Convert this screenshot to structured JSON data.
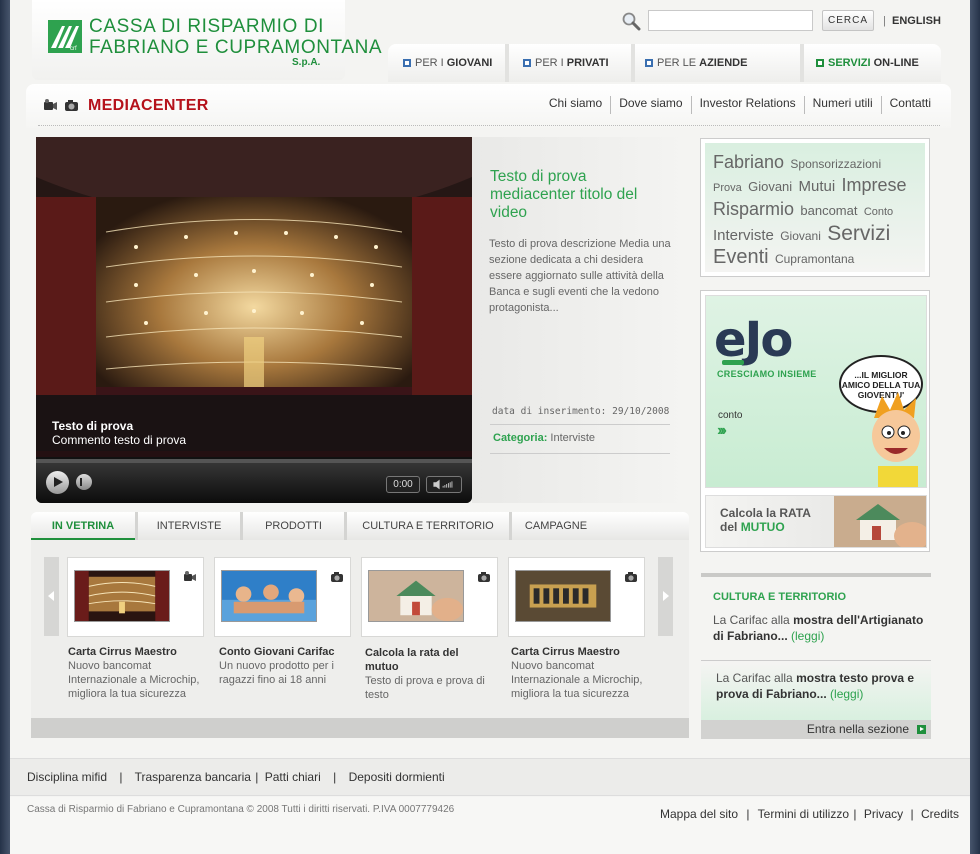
{
  "brand": {
    "line1": "CASSA DI RISPARMIO DI",
    "line2": "FABRIANO E CUPRAMONTANA",
    "spa": "S.p.A."
  },
  "search": {
    "placeholder": "",
    "button": "CERCA"
  },
  "lang": {
    "separator": "|",
    "label": "ENGLISH"
  },
  "main_nav": [
    {
      "prefix": "PER I",
      "label": "GIOVANI"
    },
    {
      "prefix": "PER I",
      "label": "PRIVATI"
    },
    {
      "prefix": "PER LE",
      "label": "AZIENDE"
    },
    {
      "prefix": "SERVIZI",
      "label": "ON-LINE"
    }
  ],
  "section": {
    "title": "MEDIACENTER"
  },
  "top_links": [
    "Chi siamo",
    "Dove siamo",
    "Investor Relations",
    "Numeri utili",
    "Contatti"
  ],
  "video": {
    "caption_title": "Testo di prova",
    "caption_sub": "Commento testo di prova",
    "time": "0:00"
  },
  "video_info": {
    "title": "Testo di prova mediacenter titolo del video",
    "description": "Testo di prova descrizione Media una sezione dedicata a chi desidera essere aggiornato sulle attività della Banca e sugli eventi che la vedono protagonista...",
    "date": "data di inserimento: 29/10/2008",
    "category_label": "Categoria:",
    "category_value": "Interviste"
  },
  "tabs": [
    "IN VETRINA",
    "INTERVISTE",
    "PRODOTTI",
    "CULTURA E TERRITORIO",
    "CAMPAGNE"
  ],
  "cards": [
    {
      "title": "Carta Cirrus Maestro",
      "desc": "Nuovo bancomat Internazionale a Microchip, migliora la tua sicurezza",
      "type": "video"
    },
    {
      "title": "Conto Giovani Carifac",
      "desc": "Un nuovo prodotto per i ragazzi fino ai 18 anni",
      "type": "photo"
    },
    {
      "title": "Calcola la rata del mutuo",
      "desc": "Testo di prova e prova di testo",
      "type": "photo"
    },
    {
      "title": "Carta Cirrus Maestro",
      "desc": "Nuovo bancomat Internazionale a Microchip, migliora la tua sicurezza",
      "type": "photo"
    }
  ],
  "tagcloud": [
    {
      "word": "Fabriano",
      "size": 18
    },
    {
      "word": "Sponsorizzazioni",
      "size": 12
    },
    {
      "word": "Prova",
      "size": 11
    },
    {
      "word": "Giovani",
      "size": 13
    },
    {
      "word": "Mutui",
      "size": 15
    },
    {
      "word": "Imprese",
      "size": 18
    },
    {
      "word": "Risparmio",
      "size": 18
    },
    {
      "word": "bancomat",
      "size": 13
    },
    {
      "word": "Conto",
      "size": 11
    },
    {
      "word": "Interviste",
      "size": 15
    },
    {
      "word": "Giovani",
      "size": 12
    },
    {
      "word": "Servizi",
      "size": 21
    },
    {
      "word": "Eventi",
      "size": 20
    },
    {
      "word": "Cupramontana",
      "size": 12
    }
  ],
  "ad": {
    "logo": "eJo",
    "tagline": "CRESCIAMO INSIEME",
    "conto": "conto",
    "arrows": "›››",
    "bubble": "...IL MIGLIOR AMICO DELLA TUA GIOVENTU'",
    "rata_line1": "Calcola la RATA",
    "rata_line2_pre": "del",
    "rata_line2_bold": "MUTUO"
  },
  "cultura": {
    "title": "CULTURA E TERRITORIO",
    "items": [
      {
        "pre": "La Carifac alla",
        "bold": "mostra dell'Artigianato di Fabriano...",
        "link": "(leggi)"
      },
      {
        "pre": "La Carifac alla",
        "bold": "mostra testo prova e prova di Fabriano...",
        "link": "(leggi)"
      }
    ],
    "enter": "Entra nella sezione"
  },
  "footer": {
    "links1": [
      "Disciplina mifid",
      "Trasparenza bancaria",
      "Patti chiari",
      "Depositi dormienti"
    ],
    "copyright": "Cassa di Risparmio di Fabriano e Cupramontana © 2008 Tutti i diritti riservati. P.IVA 0007779426",
    "links2": [
      "Mappa del sito",
      "Termini di utilizzo",
      "Privacy",
      "Credits"
    ]
  },
  "colors": {
    "brand_green": "#1f8f3c",
    "accent_green": "#2ea24f",
    "section_red": "#b5121b"
  }
}
